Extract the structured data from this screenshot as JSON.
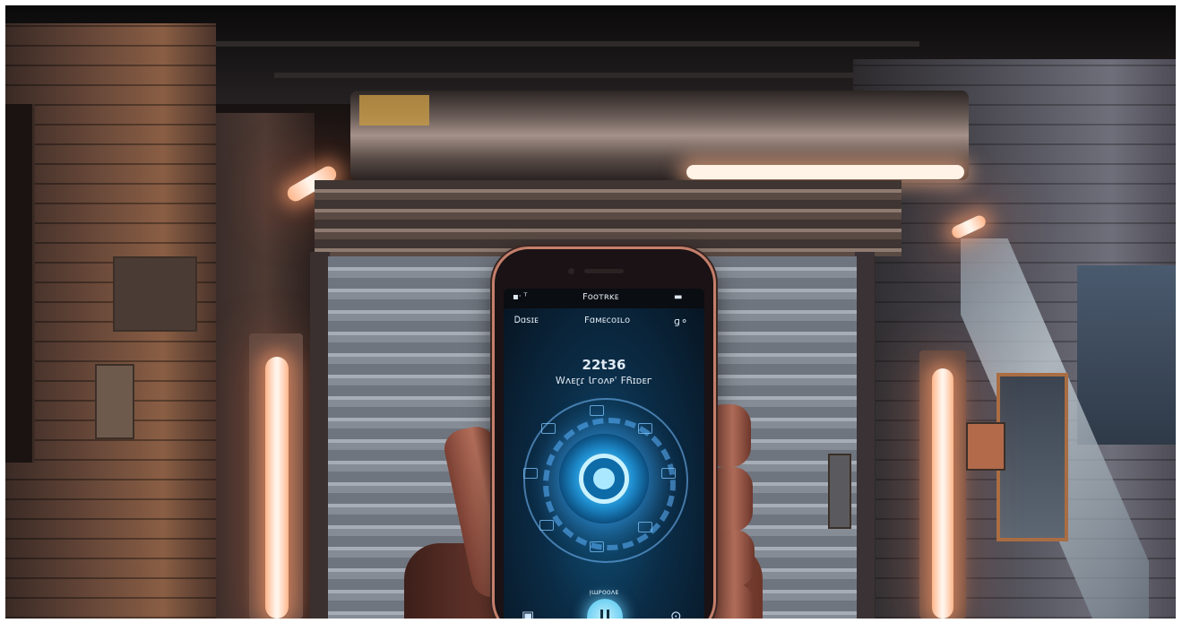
{
  "phone": {
    "status_left": "▪ᐧ ᵀ",
    "status_center": "Fᴏᴏᴛʀᴋᴇ",
    "nav_left": "Ꭰɑsɪᴇ",
    "nav_center": "Fɑᴍᴇᴄᴏɪʟᴏ",
    "nav_right": "ɡ⚬",
    "time": "22t36",
    "subtitle": "Wᴧᴇɽɾ Ɩᴦᴏᴧᴘʿ FᏲɪᴅᴇᴦ",
    "bottom_label": "ᴉɯᴩᴏᴏᴧᴇ",
    "accent_color": "#6fd0f2"
  }
}
